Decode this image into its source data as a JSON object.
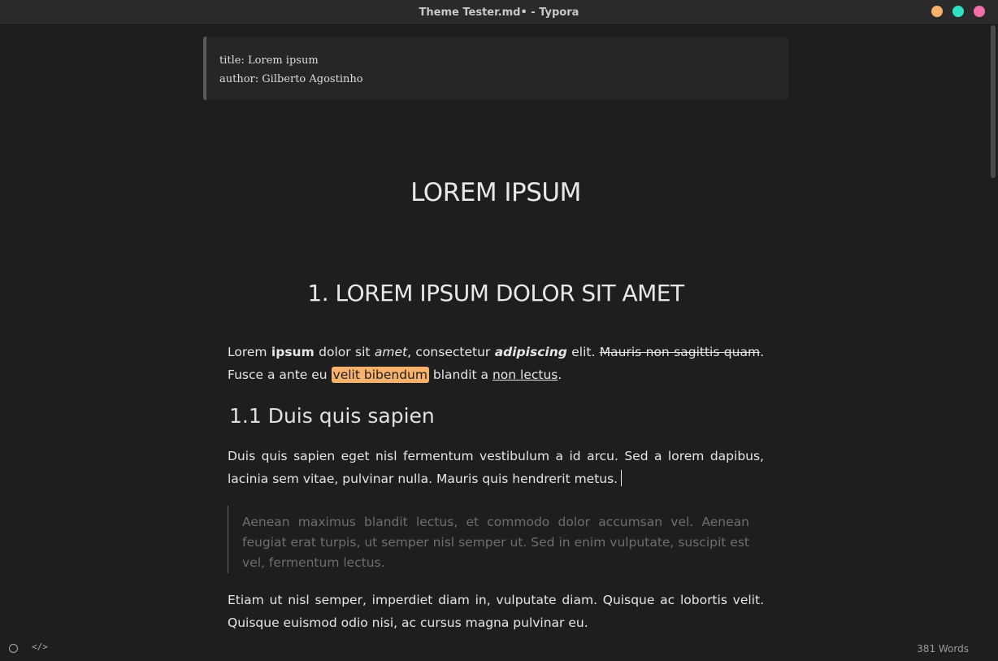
{
  "window": {
    "title": "Theme Tester.md• - Typora",
    "colors": {
      "minimize": "#f9b26b",
      "maximize": "#2fe0c4",
      "close": "#f46fa5"
    }
  },
  "front_matter": {
    "line1": "title: Lorem ipsum",
    "line2": "author: Gilberto Agostinho"
  },
  "document": {
    "h1": "LOREM IPSUM",
    "h2": "1. LOREM IPSUM DOLOR SIT AMET",
    "p1": {
      "t1": "Lorem ",
      "bold": "ipsum",
      "t2": " dolor sit ",
      "italic": "amet",
      "t3": ", consectetur ",
      "bold_italic": "adipiscing",
      "t4": " elit. ",
      "strike": "Mauris non sagittis quam",
      "t5": ". Fusce a ante eu ",
      "highlight": "velit bibendum",
      "t6": " blandit a ",
      "underline": "non lectus",
      "t7": "."
    },
    "h3": "1.1 Duis quis sapien",
    "p2": "Duis quis sapien eget nisl fermentum vestibulum a id arcu. Sed a lorem dapibus, lacinia sem vitae, pulvinar nulla. Mauris quis hendrerit metus.",
    "blockquote": "Aenean maximus blandit lectus, et commodo dolor accumsan vel. Aenean feugiat erat turpis, ut semper nisl semper ut. Sed in enim vulputate,  suscipit est vel, fermentum lectus.",
    "p4": "Etiam ut nisl semper, imperdiet diam in, vulputate diam. Quisque ac  lobortis velit. Quisque euismod odio nisi, ac cursus magna pulvinar eu."
  },
  "statusbar": {
    "outline_icon": "circle-icon",
    "source_icon": "code-icon",
    "source_glyph": "</>",
    "word_count": "381 Words"
  }
}
